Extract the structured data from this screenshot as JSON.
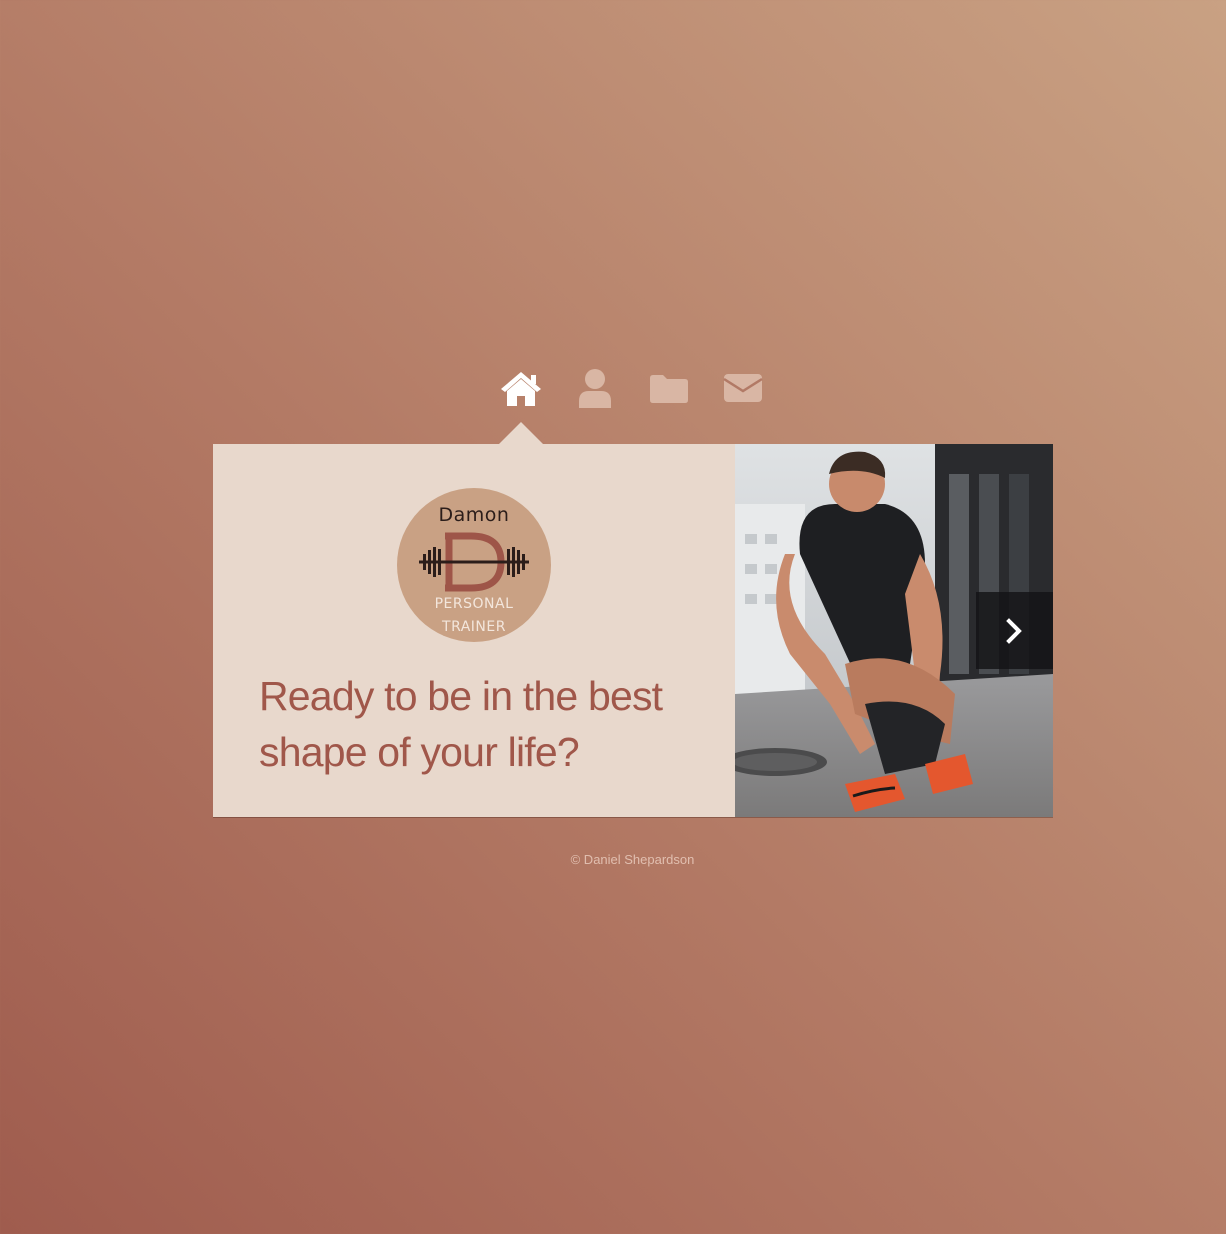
{
  "nav": {
    "items": [
      {
        "icon": "home-icon",
        "active": true
      },
      {
        "icon": "user-icon",
        "active": false
      },
      {
        "icon": "folder-icon",
        "active": false
      },
      {
        "icon": "envelope-icon",
        "active": false
      }
    ]
  },
  "logo": {
    "top_text": "Damon",
    "line1": "PERSONAL",
    "line2": "TRAINER"
  },
  "hero": {
    "headline": "Ready to be in the best shape of your life?",
    "next_icon": "chevron-right-icon"
  },
  "footer": {
    "copyright": "© Daniel Shepardson"
  },
  "colors": {
    "card_bg": "#e8d8cc",
    "headline": "#a0574a",
    "logo_circle": "#c9a184",
    "nav_active": "#ffffff",
    "nav_inactive": "#d9b6a4"
  }
}
